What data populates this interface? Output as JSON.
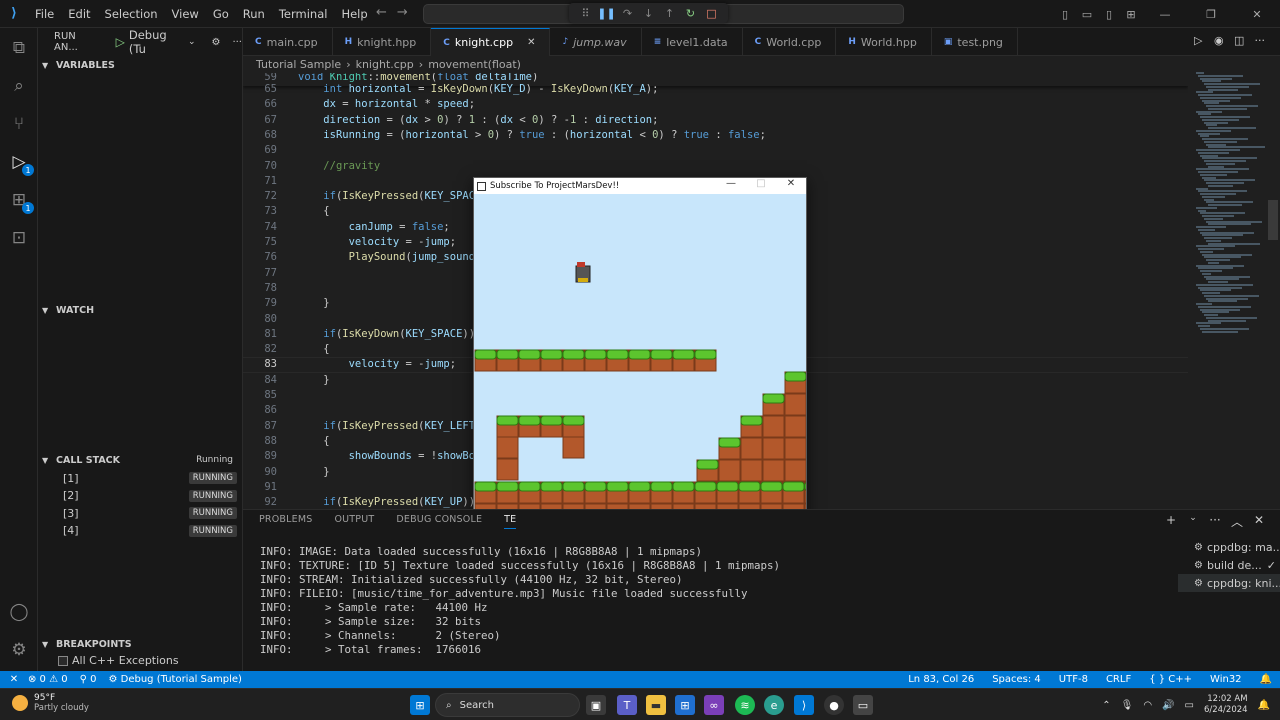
{
  "menu": [
    "File",
    "Edit",
    "Selection",
    "View",
    "Go",
    "Run",
    "Terminal",
    "Help"
  ],
  "sidebar": {
    "run_label": "RUN AN...",
    "config": "Debug (Tu",
    "sections": {
      "variables": "VARIABLES",
      "watch": "WATCH",
      "callstack": "CALL STACK",
      "callstack_state": "Running",
      "breakpoints": "BREAKPOINTS"
    },
    "stack": [
      {
        "name": "[1]",
        "state": "RUNNING"
      },
      {
        "name": "[2]",
        "state": "RUNNING"
      },
      {
        "name": "[3]",
        "state": "RUNNING"
      },
      {
        "name": "[4]",
        "state": "RUNNING"
      }
    ],
    "breakpoint_item": "All C++ Exceptions"
  },
  "tabs": [
    {
      "icon": "C",
      "label": "main.cpp",
      "active": false,
      "italic": false
    },
    {
      "icon": "H",
      "label": "knight.hpp",
      "active": false,
      "italic": false
    },
    {
      "icon": "C",
      "label": "knight.cpp",
      "active": true,
      "italic": false
    },
    {
      "icon": "♪",
      "label": "jump.wav",
      "active": false,
      "italic": true
    },
    {
      "icon": "≡",
      "label": "level1.data",
      "active": false,
      "italic": false
    },
    {
      "icon": "C",
      "label": "World.cpp",
      "active": false,
      "italic": false
    },
    {
      "icon": "H",
      "label": "World.hpp",
      "active": false,
      "italic": false
    },
    {
      "icon": "▣",
      "label": "test.png",
      "active": false,
      "italic": false
    }
  ],
  "breadcrumb": [
    "Tutorial Sample",
    "›",
    "knight.cpp",
    "›",
    "movement(float)"
  ],
  "code_lines": [
    {
      "n": "59",
      "html": "<span class=\"kw\">void</span> <span class=\"ty\">Knight</span>::<span class=\"fn\">movement</span>(<span class=\"kw\">float</span> <span class=\"vr\">deltaTime</span>)"
    },
    {
      "n": "65",
      "html": "    <span class=\"kw\">int</span> <span class=\"vr\">horizontal</span> = <span class=\"fn\">IsKeyDown</span>(<span class=\"vr\">KEY_D</span>) - <span class=\"fn\">IsKeyDown</span>(<span class=\"vr\">KEY_A</span>);"
    },
    {
      "n": "66",
      "html": "    <span class=\"vr\">dx</span> = <span class=\"vr\">horizontal</span> * <span class=\"vr\">speed</span>;"
    },
    {
      "n": "67",
      "html": "    <span class=\"vr\">direction</span> = (<span class=\"vr\">dx</span> &gt; <span class=\"nm\">0</span>) ? <span class=\"nm\">1</span> : (<span class=\"vr\">dx</span> &lt; <span class=\"nm\">0</span>) ? -<span class=\"nm\">1</span> : <span class=\"vr\">direction</span>;"
    },
    {
      "n": "68",
      "html": "    <span class=\"vr\">isRunning</span> = (<span class=\"vr\">horizontal</span> &gt; <span class=\"nm\">0</span>) ? <span class=\"kw\">true</span> : (<span class=\"vr\">horizontal</span> &lt; <span class=\"nm\">0</span>) ? <span class=\"kw\">true</span> : <span class=\"kw\">false</span>;"
    },
    {
      "n": "69",
      "html": ""
    },
    {
      "n": "70",
      "html": "    <span class=\"cm\">//gravity</span>"
    },
    {
      "n": "71",
      "html": ""
    },
    {
      "n": "72",
      "html": "    <span class=\"kw\">if</span>(<span class=\"fn\">IsKeyPressed</span>(<span class=\"vr\">KEY_SPACE</span>"
    },
    {
      "n": "73",
      "html": "    {"
    },
    {
      "n": "74",
      "html": "        <span class=\"vr\">canJump</span> = <span class=\"kw\">false</span>;"
    },
    {
      "n": "75",
      "html": "        <span class=\"vr\">velocity</span> = -<span class=\"vr\">jump</span>;"
    },
    {
      "n": "76",
      "html": "        <span class=\"fn\">PlaySound</span>(<span class=\"vr\">jump_sound</span>"
    },
    {
      "n": "77",
      "html": ""
    },
    {
      "n": "78",
      "html": ""
    },
    {
      "n": "79",
      "html": "    }"
    },
    {
      "n": "80",
      "html": ""
    },
    {
      "n": "81",
      "html": "    <span class=\"kw\">if</span>(<span class=\"fn\">IsKeyDown</span>(<span class=\"vr\">KEY_SPACE</span>))"
    },
    {
      "n": "82",
      "html": "    {"
    },
    {
      "n": "83",
      "html": "        <span class=\"vr\">velocity</span> = -<span class=\"vr\">jump</span>;"
    },
    {
      "n": "84",
      "html": "    }"
    },
    {
      "n": "85",
      "html": ""
    },
    {
      "n": "86",
      "html": ""
    },
    {
      "n": "87",
      "html": "    <span class=\"kw\">if</span>(<span class=\"fn\">IsKeyPressed</span>(<span class=\"vr\">KEY_LEFT_</span>"
    },
    {
      "n": "88",
      "html": "    {"
    },
    {
      "n": "89",
      "html": "        <span class=\"vr\">showBounds</span> = !<span class=\"vr\">showBou</span>"
    },
    {
      "n": "90",
      "html": "    }"
    },
    {
      "n": "91",
      "html": ""
    },
    {
      "n": "92",
      "html": "    <span class=\"kw\">if</span>(<span class=\"fn\">IsKeyPressed</span>(<span class=\"vr\">KEY_UP</span>))"
    }
  ],
  "current_line": "83",
  "game_window": {
    "title": "Subscribe To ProjectMarsDev!!",
    "colors": {
      "sky": "#c8e6fb",
      "grass": "#5cc52e",
      "dirt": "#b3582b"
    }
  },
  "panel": {
    "tabs": [
      "PROBLEMS",
      "OUTPUT",
      "DEBUG CONSOLE",
      "TE"
    ],
    "active_tab": "TE",
    "lines": [
      "INFO: IMAGE: Data loaded successfully (16x16 | R8G8B8A8 | 1 mipmaps)",
      "INFO: TEXTURE: [ID 5] Texture loaded successfully (16x16 | R8G8B8A8 | 1 mipmaps)",
      "INFO: STREAM: Initialized successfully (44100 Hz, 32 bit, Stereo)",
      "INFO: FILEIO: [music/time_for_adventure.mp3] Music file loaded successfully",
      "INFO:     > Sample rate:   44100 Hz",
      "INFO:     > Sample size:   32 bits",
      "INFO:     > Channels:      2 (Stereo)",
      "INFO:     > Total frames:  1766016"
    ],
    "terminals": [
      {
        "label": "cppdbg: ma...",
        "check": false,
        "active": false
      },
      {
        "label": "build de...",
        "check": true,
        "active": false
      },
      {
        "label": "cppdbg: kni...",
        "check": false,
        "active": true
      }
    ]
  },
  "statusbar": {
    "errors": "⊗ 0 ⚠ 0",
    "ports": "⚲ 0",
    "debug": "Debug (Tutorial Sample)",
    "position": "Ln 83, Col 26",
    "spaces": "Spaces: 4",
    "encoding": "UTF-8",
    "eol": "CRLF",
    "language": "{ } C++",
    "platform": "Win32"
  },
  "taskbar": {
    "temp": "95°F",
    "weather": "Partly cloudy",
    "search": "Search",
    "time": "12:02 AM",
    "date": "6/24/2024"
  },
  "colors": {
    "accent": "#0078d4",
    "bg": "#1f1f1f",
    "sidebar": "#181818"
  }
}
